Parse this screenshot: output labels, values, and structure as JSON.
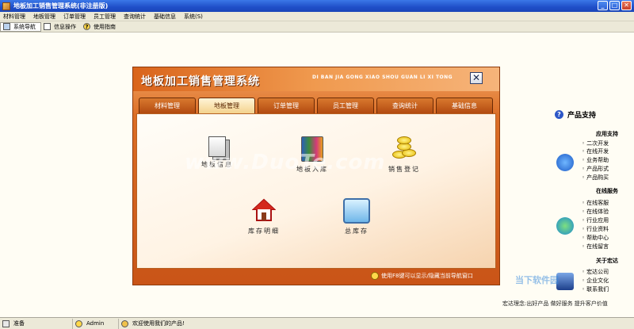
{
  "window": {
    "title": "地板加工销售管理系统(非注册版)",
    "minimize": "_",
    "maximize": "□",
    "close": "✕"
  },
  "menu": [
    "材料管理",
    "地板管理",
    "订单管理",
    "员工管理",
    "查询统计",
    "基础信息",
    "系统(S)"
  ],
  "toolbar": [
    {
      "label": "系统导航",
      "icon": "navigation-icon",
      "active": true
    },
    {
      "label": "信息操作",
      "icon": "info-icon",
      "active": false
    },
    {
      "label": "使用指南",
      "icon": "help-icon",
      "active": false
    }
  ],
  "panel": {
    "title": "地板加工销售管理系统",
    "subtitle": "DI BAN JIA GONG XIAO SHOU GUAN LI XI TONG",
    "close": "✕",
    "tabs": [
      "材料管理",
      "地板管理",
      "订单管理",
      "员工管理",
      "查询统计",
      "基础信息"
    ],
    "selected_tab": "地板管理",
    "tiles": [
      {
        "label": "地板信息",
        "icon": "documents-icon"
      },
      {
        "label": "地板入库",
        "icon": "books-inbound-icon"
      },
      {
        "label": "销售登记",
        "icon": "coins-icon"
      },
      {
        "label": "库存明细",
        "icon": "house-icon"
      },
      {
        "label": "总库存",
        "icon": "monitor-icon"
      }
    ],
    "footer_hint": "使用F8键可以显示/隐藏当前导航窗口"
  },
  "watermark": "www.DuoTe.com",
  "sidebar": {
    "title": "产品支持",
    "sections": [
      {
        "heading": "应用支持",
        "items": [
          "二次开发",
          "在线开发",
          "业务帮助",
          "产品形式",
          "产品购买"
        ]
      },
      {
        "heading": "在线服务",
        "items": [
          "在线客服",
          "在线体验",
          "行业应用",
          "行业资料",
          "帮助中心",
          "在线留言"
        ]
      },
      {
        "heading": "关于宏达",
        "items": [
          "宏达公司",
          "企业文化",
          "联系我们"
        ]
      }
    ]
  },
  "slogan": "宏达理念:出好产品 做好服务 提升客户价值",
  "corner_watermark": "当下软件园",
  "statusbar": {
    "ready": "准备",
    "user": "Admin",
    "welcome": "欢迎使用我们的产品!"
  }
}
